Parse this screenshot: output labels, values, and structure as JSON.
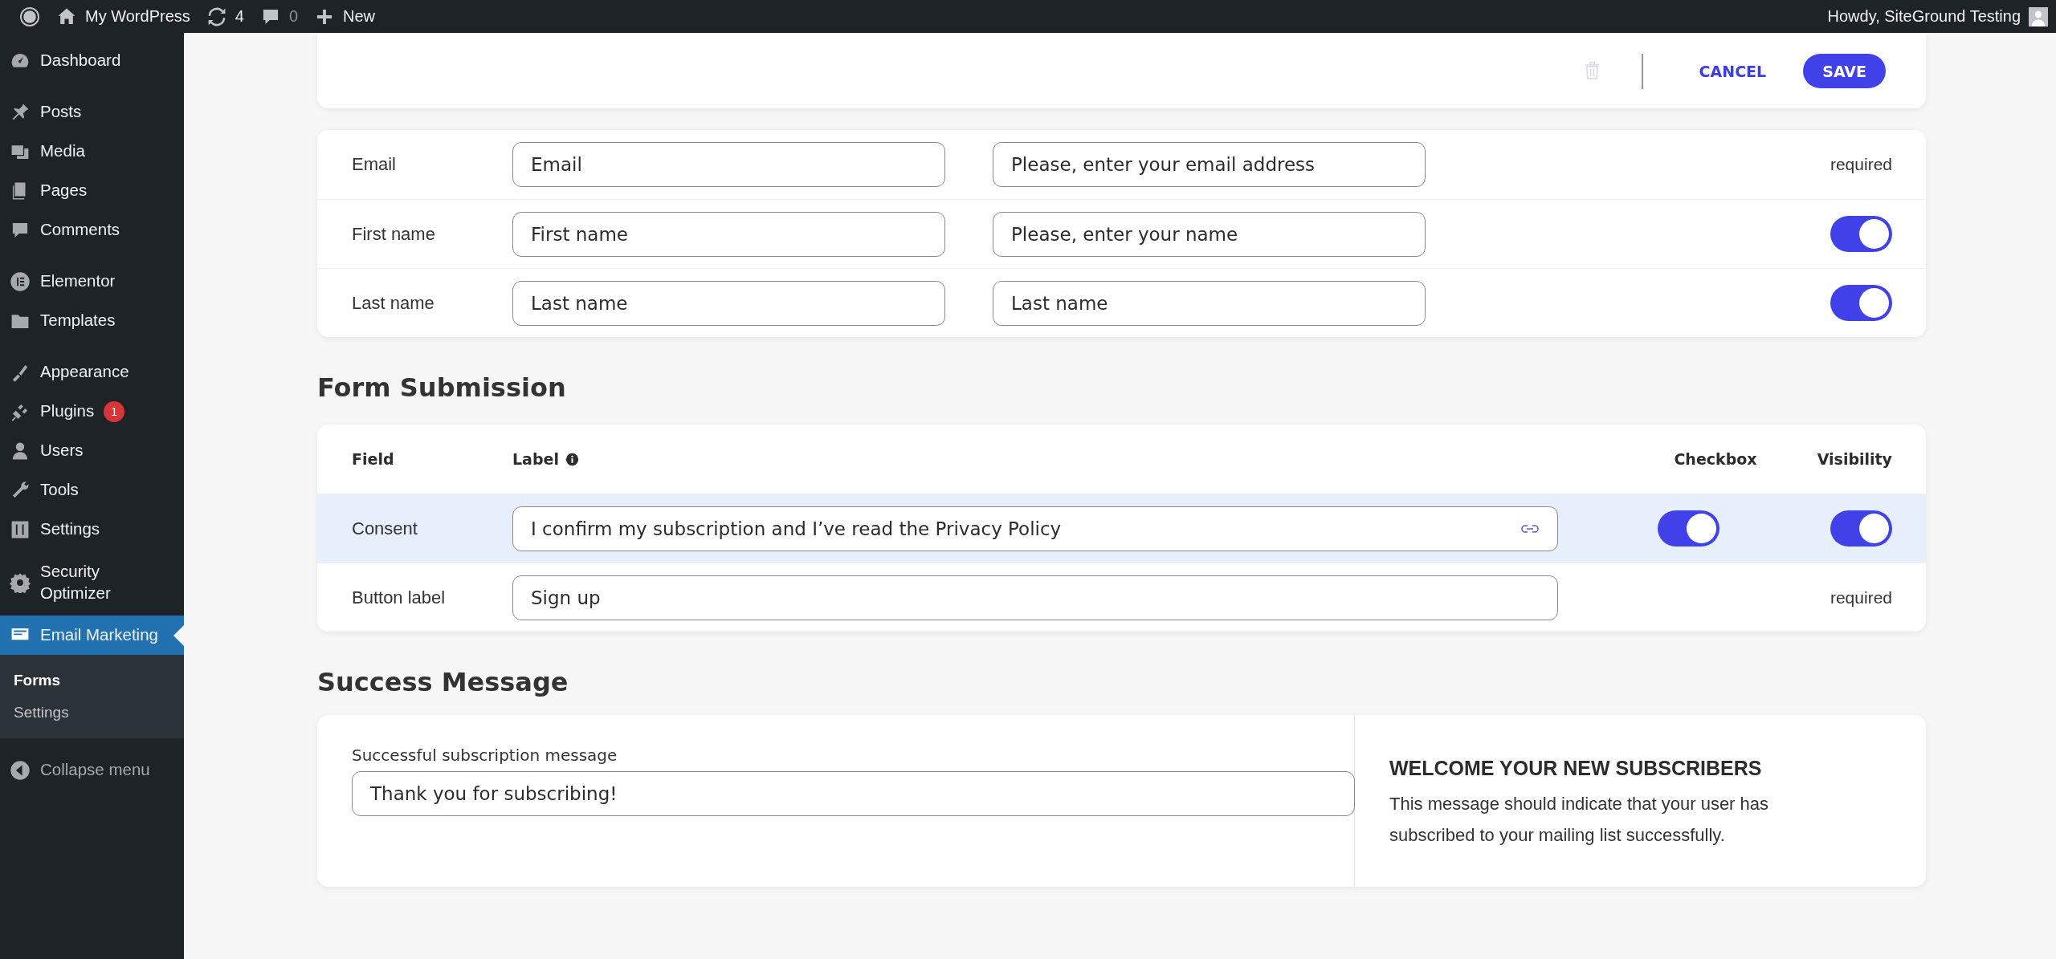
{
  "admin_bar": {
    "site": "My WordPress",
    "updates": "4",
    "comments": "0",
    "new": "New",
    "greeting": "Howdy, SiteGround Testing"
  },
  "sidebar": {
    "groups": [
      [
        {
          "label": "Dashboard",
          "selected": false
        }
      ],
      [
        {
          "label": "Posts",
          "selected": false
        },
        {
          "label": "Media",
          "selected": false
        },
        {
          "label": "Pages",
          "selected": false
        },
        {
          "label": "Comments",
          "selected": false
        }
      ],
      [
        {
          "label": "Elementor",
          "selected": false
        },
        {
          "label": "Templates",
          "selected": false
        }
      ],
      [
        {
          "label": "Appearance",
          "selected": false
        },
        {
          "label": "Plugins",
          "selected": false,
          "badge": "1"
        },
        {
          "label": "Users",
          "selected": false
        },
        {
          "label": "Tools",
          "selected": false
        },
        {
          "label": "Settings",
          "selected": false
        }
      ],
      [
        {
          "label": "Security Optimizer",
          "selected": false
        }
      ],
      [
        {
          "label": "Email Marketing",
          "selected": true,
          "children": [
            {
              "label": "Forms",
              "selected": true
            },
            {
              "label": "Settings",
              "selected": false
            }
          ]
        }
      ]
    ],
    "collapse": "Collapse menu"
  },
  "header": {
    "delete_disabled": true,
    "cancel": "CANCEL",
    "save": "SAVE"
  },
  "fields": [
    {
      "name": "Email",
      "label_value": "Email",
      "message_value": "Please, enter your email address",
      "kind": "required",
      "status": "required"
    },
    {
      "name": "First name",
      "label_value": "First name",
      "message_value": "Please, enter your name",
      "kind": "toggle",
      "on": true
    },
    {
      "name": "Last name",
      "label_value": "Last name",
      "message_value": "Last name",
      "kind": "toggle",
      "on": true
    }
  ],
  "submission": {
    "title": "Form Submission",
    "columns": [
      "Field",
      "Label",
      "Checkbox",
      "Visibility"
    ],
    "rows": [
      {
        "field": "Consent",
        "value": "I confirm my subscription and I’ve read the Privacy Policy",
        "highlighted": true,
        "kind": "consent",
        "checkbox_on": true,
        "visible": true
      },
      {
        "field": "Button label",
        "value": "Sign up",
        "highlighted": false,
        "kind": "button",
        "status": "required"
      }
    ]
  },
  "success": {
    "title": "Success Message",
    "field_label": "Successful subscription message",
    "value": "Thank you for subscribing!",
    "tip_title": "WELCOME YOUR NEW SUBSCRIBERS",
    "tip_text": "This message should indicate that your user has subscribed to your mailing list successfully."
  }
}
